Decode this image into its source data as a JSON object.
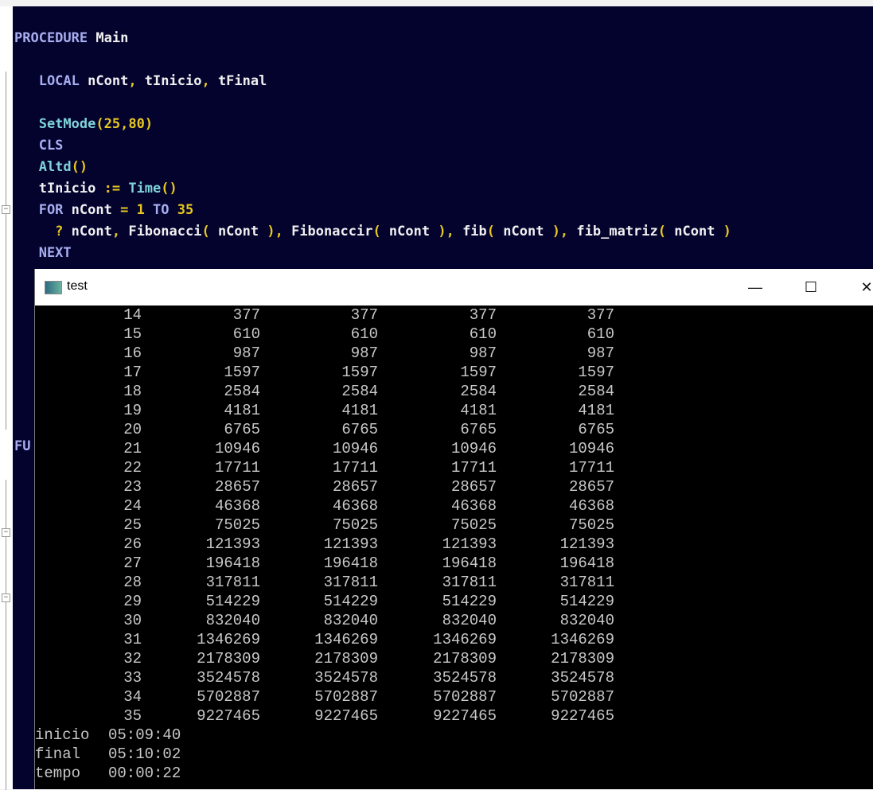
{
  "editor": {
    "lines": [
      [
        [
          "kw",
          "PROCEDURE "
        ],
        [
          "id",
          "Main"
        ]
      ],
      [
        [
          "kw",
          "   LOCAL "
        ],
        [
          "id",
          "nCont"
        ],
        [
          "pn",
          ", "
        ],
        [
          "id",
          "tInicio"
        ],
        [
          "pn",
          ", "
        ],
        [
          "id",
          "tFinal"
        ]
      ],
      [
        [
          "fn",
          "   SetMode"
        ],
        [
          "pn",
          "("
        ],
        [
          "num",
          "25"
        ],
        [
          "pn",
          ","
        ],
        [
          "num",
          "80"
        ],
        [
          "pn",
          ")"
        ]
      ],
      [
        [
          "kw",
          "   CLS"
        ]
      ],
      [
        [
          "fn",
          "   Altd"
        ],
        [
          "pn",
          "()"
        ]
      ],
      [
        [
          "id",
          "   tInicio "
        ],
        [
          "pn",
          ":= "
        ],
        [
          "fn",
          "Time"
        ],
        [
          "pn",
          "()"
        ]
      ],
      [
        [
          "kw",
          "   FOR "
        ],
        [
          "id",
          "nCont "
        ],
        [
          "pn",
          "= "
        ],
        [
          "num",
          "1 "
        ],
        [
          "kw",
          "TO "
        ],
        [
          "num",
          "35"
        ]
      ],
      [
        [
          "pn",
          "     ? "
        ],
        [
          "id",
          "nCont"
        ],
        [
          "pn",
          ", "
        ],
        [
          "id",
          "Fibonacci"
        ],
        [
          "pn",
          "( "
        ],
        [
          "id",
          "nCont "
        ],
        [
          "pn",
          "), "
        ],
        [
          "id",
          "Fibonaccir"
        ],
        [
          "pn",
          "( "
        ],
        [
          "id",
          "nCont "
        ],
        [
          "pn",
          "), "
        ],
        [
          "id",
          "fib"
        ],
        [
          "pn",
          "( "
        ],
        [
          "id",
          "nCont "
        ],
        [
          "pn",
          "), "
        ],
        [
          "id",
          "fib_matriz"
        ],
        [
          "pn",
          "( "
        ],
        [
          "id",
          "nCont "
        ],
        [
          "pn",
          ")"
        ]
      ],
      [
        [
          "kw",
          "   NEXT"
        ]
      ]
    ],
    "partial_label": "FU"
  },
  "window": {
    "title": "test",
    "minimize": "—",
    "maximize": "☐",
    "close": "✕"
  },
  "console": {
    "rows": [
      [
        "14",
        "377",
        "377",
        "377",
        "377"
      ],
      [
        "15",
        "610",
        "610",
        "610",
        "610"
      ],
      [
        "16",
        "987",
        "987",
        "987",
        "987"
      ],
      [
        "17",
        "1597",
        "1597",
        "1597",
        "1597"
      ],
      [
        "18",
        "2584",
        "2584",
        "2584",
        "2584"
      ],
      [
        "19",
        "4181",
        "4181",
        "4181",
        "4181"
      ],
      [
        "20",
        "6765",
        "6765",
        "6765",
        "6765"
      ],
      [
        "21",
        "10946",
        "10946",
        "10946",
        "10946"
      ],
      [
        "22",
        "17711",
        "17711",
        "17711",
        "17711"
      ],
      [
        "23",
        "28657",
        "28657",
        "28657",
        "28657"
      ],
      [
        "24",
        "46368",
        "46368",
        "46368",
        "46368"
      ],
      [
        "25",
        "75025",
        "75025",
        "75025",
        "75025"
      ],
      [
        "26",
        "121393",
        "121393",
        "121393",
        "121393"
      ],
      [
        "27",
        "196418",
        "196418",
        "196418",
        "196418"
      ],
      [
        "28",
        "317811",
        "317811",
        "317811",
        "317811"
      ],
      [
        "29",
        "514229",
        "514229",
        "514229",
        "514229"
      ],
      [
        "30",
        "832040",
        "832040",
        "832040",
        "832040"
      ],
      [
        "31",
        "1346269",
        "1346269",
        "1346269",
        "1346269"
      ],
      [
        "32",
        "2178309",
        "2178309",
        "2178309",
        "2178309"
      ],
      [
        "33",
        "3524578",
        "3524578",
        "3524578",
        "3524578"
      ],
      [
        "34",
        "5702887",
        "5702887",
        "5702887",
        "5702887"
      ],
      [
        "35",
        "9227465",
        "9227465",
        "9227465",
        "9227465"
      ]
    ],
    "summary": [
      {
        "label": "inicio",
        "value": "05:09:40"
      },
      {
        "label": "final",
        "value": "05:10:02"
      },
      {
        "label": "tempo",
        "value": "00:00:22"
      }
    ]
  }
}
